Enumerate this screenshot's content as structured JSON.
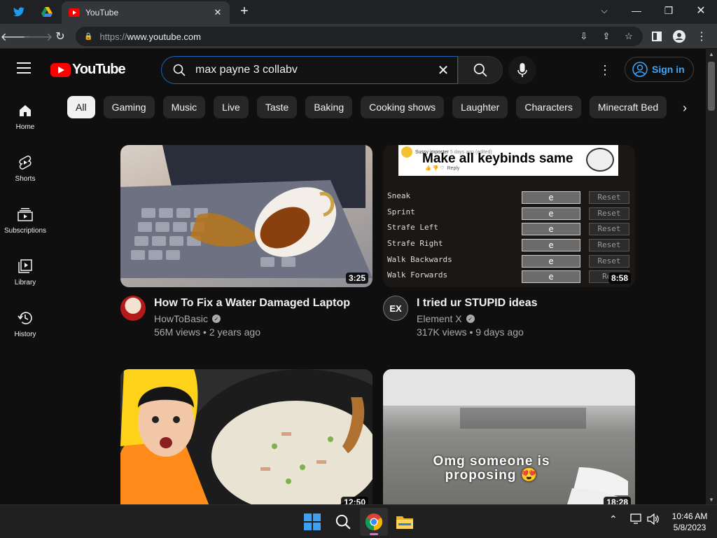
{
  "browser": {
    "active_tab_title": "YouTube",
    "url_scheme": "https://",
    "url_host": "www.youtube.com"
  },
  "masthead": {
    "logo_text": "YouTube",
    "search_value": "max payne 3 collabv",
    "sign_in_label": "Sign in"
  },
  "chips": [
    "All",
    "Gaming",
    "Music",
    "Live",
    "Taste",
    "Baking",
    "Cooking shows",
    "Laughter",
    "Characters",
    "Minecraft Bed"
  ],
  "sidebar": [
    {
      "label": "Home",
      "icon": "home-icon"
    },
    {
      "label": "Shorts",
      "icon": "shorts-icon"
    },
    {
      "label": "Subscriptions",
      "icon": "subscriptions-icon"
    },
    {
      "label": "Library",
      "icon": "library-icon"
    },
    {
      "label": "History",
      "icon": "history-icon"
    }
  ],
  "videos": [
    {
      "title": "How To Fix a Water Damaged Laptop",
      "channel": "HowToBasic",
      "views": "56M views",
      "age": "2 years ago",
      "duration": "3:25"
    },
    {
      "title": "I tried ur STUPID ideas",
      "channel": "Element X",
      "views": "317K views",
      "age": "9 days ago",
      "duration": "8:58",
      "avatar_text": "EX",
      "thumb": {
        "comment_user": "Sussy imposter",
        "comment_meta": "5 days ago (edited)",
        "comment_text": "Make all keybinds same",
        "reply": "Reply",
        "keybinds": [
          {
            "action": "Sneak",
            "key": "e",
            "reset": "Reset"
          },
          {
            "action": "Sprint",
            "key": "e",
            "reset": "Reset"
          },
          {
            "action": "Strafe Left",
            "key": "e",
            "reset": "Reset"
          },
          {
            "action": "Strafe Right",
            "key": "e",
            "reset": "Reset"
          },
          {
            "action": "Walk Backwards",
            "key": "e",
            "reset": "Reset"
          },
          {
            "action": "Walk Forwards",
            "key": "e",
            "reset": "Res"
          }
        ]
      }
    },
    {
      "duration": "12:50"
    },
    {
      "duration": "18:28",
      "overlay_text": "Omg someone is proposing 😍"
    }
  ],
  "clock": {
    "time": "10:46 AM",
    "date": "5/8/2023"
  },
  "colors": {
    "accent": "#ff0000",
    "link": "#3ea6ff",
    "background": "#0f0f0f"
  }
}
